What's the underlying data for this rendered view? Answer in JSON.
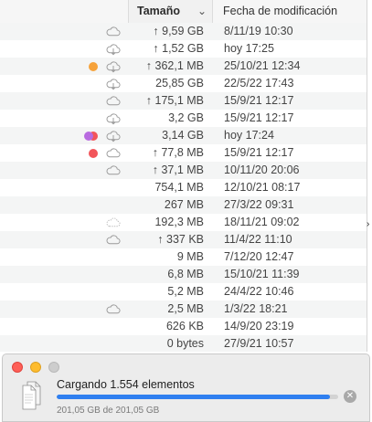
{
  "header": {
    "size_label": "Tamaño",
    "date_label": "Fecha de modificación"
  },
  "rows": [
    {
      "size": "↑ 9,59 GB",
      "date": "8/11/19 10:30",
      "icon": "cloud-icon"
    },
    {
      "size": "↑ 1,52 GB",
      "date": "hoy 17:25",
      "icon": "cloud-download-icon"
    },
    {
      "size": "↑ 362,1 MB",
      "date": "25/10/21 12:34",
      "icon": "cloud-download-icon",
      "tags": [
        "#f6a23a"
      ]
    },
    {
      "size": "25,85 GB",
      "date": "22/5/22 17:43",
      "icon": "cloud-download-icon"
    },
    {
      "size": "↑ 175,1 MB",
      "date": "15/9/21 12:17",
      "icon": "cloud-icon"
    },
    {
      "size": "3,2 GB",
      "date": "15/9/21 12:17",
      "icon": "cloud-download-icon"
    },
    {
      "size": "3,14 GB",
      "date": "hoy 17:24",
      "icon": "cloud-download-icon",
      "tags": [
        "#b86be0",
        "#f2555a"
      ]
    },
    {
      "size": "↑ 77,8 MB",
      "date": "15/9/21 12:17",
      "icon": "cloud-icon",
      "tags": [
        "#f2555a"
      ]
    },
    {
      "size": "↑ 37,1 MB",
      "date": "10/11/20 20:06",
      "icon": "cloud-icon"
    },
    {
      "size": "754,1 MB",
      "date": "12/10/21 08:17",
      "icon": ""
    },
    {
      "size": "267 MB",
      "date": "27/3/22 09:31",
      "icon": ""
    },
    {
      "size": "192,3 MB",
      "date": "18/11/21 09:02",
      "icon": "cloud-dashed-icon"
    },
    {
      "size": "↑ 337 KB",
      "date": "11/4/22 11:10",
      "icon": "cloud-icon"
    },
    {
      "size": "9 MB",
      "date": "7/12/20 12:47",
      "icon": ""
    },
    {
      "size": "6,8 MB",
      "date": "15/10/21 11:39",
      "icon": ""
    },
    {
      "size": "5,2 MB",
      "date": "24/4/22 10:46",
      "icon": ""
    },
    {
      "size": "2,5 MB",
      "date": "1/3/22 18:21",
      "icon": "cloud-icon"
    },
    {
      "size": "626 KB",
      "date": "14/9/20 23:19",
      "icon": ""
    },
    {
      "size": "0 bytes",
      "date": "27/9/21 10:57",
      "icon": ""
    }
  ],
  "progress": {
    "title": "Cargando 1.554 elementos",
    "subtitle": "201,05 GB de 201,05 GB",
    "fraction": 0.97
  },
  "colors": {
    "accent": "#2f7ff0",
    "close": "#fe5f57",
    "minimize": "#febc2e",
    "zoom_disabled": "#cdcdcd"
  }
}
